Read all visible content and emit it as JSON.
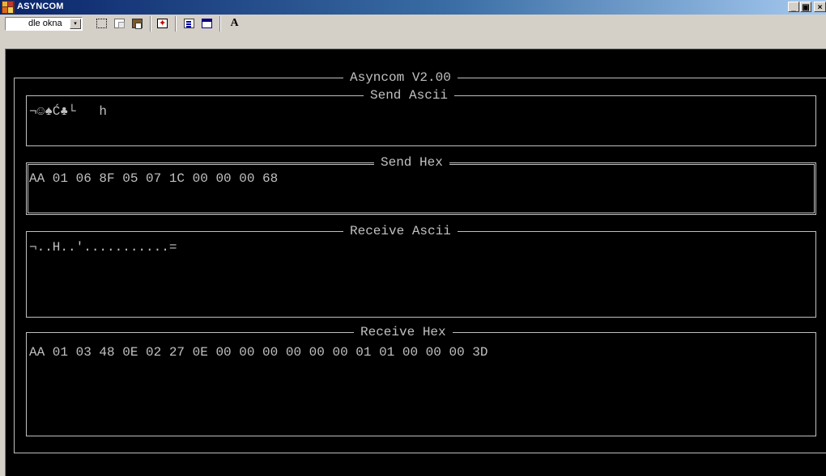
{
  "window": {
    "title": "ASYNCOM",
    "buttons": [
      "_",
      "▣",
      "×"
    ]
  },
  "toolbar": {
    "size_selector": {
      "value": "dle okna",
      "arrow": "▾"
    },
    "buttons": [
      {
        "name": "mark-icon"
      },
      {
        "name": "copy-icon"
      },
      {
        "name": "paste-icon"
      },
      {
        "name": "fullscreen-icon"
      },
      {
        "name": "properties-icon"
      },
      {
        "name": "background-icon"
      },
      {
        "name": "font-icon",
        "label": "A"
      }
    ]
  },
  "console": {
    "frame_title": "Asyncom V2.00",
    "send_ascii": {
      "label": "Send Ascii",
      "value": "¬☺♠Ć♣└   h"
    },
    "send_hex": {
      "label": "Send Hex",
      "value": "AA 01 06 8F 05 07 1C 00 00 00 68"
    },
    "receive_ascii": {
      "label": "Receive Ascii",
      "value": "¬..H..'...........="
    },
    "receive_hex": {
      "label": "Receive Hex",
      "value": "AA 01 03 48 0E 02 27 0E 00 00 00 00 00 00 01 01 00 00 00 3D"
    }
  },
  "colors": {
    "console_bg": "#000000",
    "console_fg": "#c0c0c0",
    "titlebar_start": "#0a246a",
    "titlebar_end": "#a6caf0",
    "chrome": "#d4d0c8"
  }
}
